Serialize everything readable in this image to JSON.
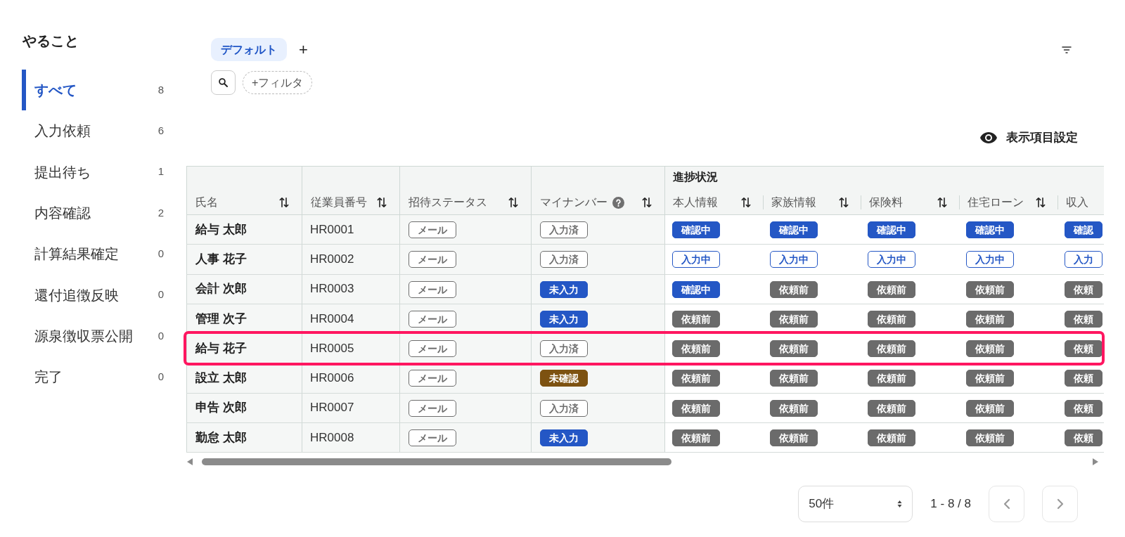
{
  "sidebar": {
    "title": "やること",
    "items": [
      {
        "label": "すべて",
        "count": "8",
        "selected": true
      },
      {
        "label": "入力依頼",
        "count": "6",
        "selected": false
      },
      {
        "label": "提出待ち",
        "count": "1",
        "selected": false
      },
      {
        "label": "内容確認",
        "count": "2",
        "selected": false
      },
      {
        "label": "計算結果確定",
        "count": "0",
        "selected": false
      },
      {
        "label": "還付追徴反映",
        "count": "0",
        "selected": false
      },
      {
        "label": "源泉徴収票公開",
        "count": "0",
        "selected": false
      },
      {
        "label": "完了",
        "count": "0",
        "selected": false
      }
    ]
  },
  "views": {
    "tabs": [
      {
        "label": "デフォルト",
        "selected": true
      }
    ],
    "add_tab": "+"
  },
  "filters": {
    "add_filter": "+フィルタ"
  },
  "column_settings": "表示項目設定",
  "table": {
    "columns": [
      {
        "label": "氏名",
        "help": false,
        "sort_icon": true
      },
      {
        "label": "従業員番号",
        "help": false,
        "sort_icon": true
      },
      {
        "label": "招待ステータス",
        "help": false,
        "sort_icon": true
      },
      {
        "label": "マイナンバー",
        "help": true,
        "sort_icon": true
      }
    ],
    "progress": {
      "label": "進捗状況",
      "columns": [
        {
          "label": "本人情報",
          "sort_icon": true
        },
        {
          "label": "家族情報",
          "sort_icon": true
        },
        {
          "label": "保険料",
          "sort_icon": true
        },
        {
          "label": "住宅ローン",
          "sort_icon": true
        },
        {
          "label": "収入",
          "sort_icon": false
        }
      ]
    },
    "rows": [
      {
        "name": "給与 太郎",
        "employee_no": "HR0001",
        "highlighted": false,
        "invitation": {
          "label": "メール",
          "kind": "outline",
          "color": "#6e6e6e"
        },
        "my_number": {
          "label": "入力済",
          "kind": "outline",
          "color": "#6e6e6e"
        },
        "progress": [
          {
            "label": "確認中",
            "kind": "solid",
            "color": "#2457c5"
          },
          {
            "label": "確認中",
            "kind": "solid",
            "color": "#2457c5"
          },
          {
            "label": "確認中",
            "kind": "solid",
            "color": "#2457c5"
          },
          {
            "label": "確認中",
            "kind": "solid",
            "color": "#2457c5"
          },
          {
            "label": "確認",
            "kind": "solid",
            "color": "#2457c5"
          }
        ]
      },
      {
        "name": "人事 花子",
        "employee_no": "HR0002",
        "highlighted": false,
        "invitation": {
          "label": "メール",
          "kind": "outline",
          "color": "#6e6e6e"
        },
        "my_number": {
          "label": "入力済",
          "kind": "outline",
          "color": "#6e6e6e"
        },
        "progress": [
          {
            "label": "入力中",
            "kind": "outline",
            "color": "#2457c5"
          },
          {
            "label": "入力中",
            "kind": "outline",
            "color": "#2457c5"
          },
          {
            "label": "入力中",
            "kind": "outline",
            "color": "#2457c5"
          },
          {
            "label": "入力中",
            "kind": "outline",
            "color": "#2457c5"
          },
          {
            "label": "入力",
            "kind": "outline",
            "color": "#2457c5"
          }
        ]
      },
      {
        "name": "会計 次郎",
        "employee_no": "HR0003",
        "highlighted": false,
        "invitation": {
          "label": "メール",
          "kind": "outline",
          "color": "#6e6e6e"
        },
        "my_number": {
          "label": "未入力",
          "kind": "solid",
          "color": "#2457c5"
        },
        "progress": [
          {
            "label": "確認中",
            "kind": "solid",
            "color": "#2457c5"
          },
          {
            "label": "依頼前",
            "kind": "solid",
            "color": "#6b6b6b"
          },
          {
            "label": "依頼前",
            "kind": "solid",
            "color": "#6b6b6b"
          },
          {
            "label": "依頼前",
            "kind": "solid",
            "color": "#6b6b6b"
          },
          {
            "label": "依頼",
            "kind": "solid",
            "color": "#6b6b6b"
          }
        ]
      },
      {
        "name": "管理 次子",
        "employee_no": "HR0004",
        "highlighted": false,
        "invitation": {
          "label": "メール",
          "kind": "outline",
          "color": "#6e6e6e"
        },
        "my_number": {
          "label": "未入力",
          "kind": "solid",
          "color": "#2457c5"
        },
        "progress": [
          {
            "label": "依頼前",
            "kind": "solid",
            "color": "#6b6b6b"
          },
          {
            "label": "依頼前",
            "kind": "solid",
            "color": "#6b6b6b"
          },
          {
            "label": "依頼前",
            "kind": "solid",
            "color": "#6b6b6b"
          },
          {
            "label": "依頼前",
            "kind": "solid",
            "color": "#6b6b6b"
          },
          {
            "label": "依頼",
            "kind": "solid",
            "color": "#6b6b6b"
          }
        ]
      },
      {
        "name": "給与 花子",
        "employee_no": "HR0005",
        "highlighted": true,
        "invitation": {
          "label": "メール",
          "kind": "outline",
          "color": "#6e6e6e"
        },
        "my_number": {
          "label": "入力済",
          "kind": "outline",
          "color": "#6e6e6e"
        },
        "progress": [
          {
            "label": "依頼前",
            "kind": "solid",
            "color": "#6b6b6b"
          },
          {
            "label": "依頼前",
            "kind": "solid",
            "color": "#6b6b6b"
          },
          {
            "label": "依頼前",
            "kind": "solid",
            "color": "#6b6b6b"
          },
          {
            "label": "依頼前",
            "kind": "solid",
            "color": "#6b6b6b"
          },
          {
            "label": "依頼",
            "kind": "solid",
            "color": "#6b6b6b"
          }
        ]
      },
      {
        "name": "設立 太郎",
        "employee_no": "HR0006",
        "highlighted": false,
        "invitation": {
          "label": "メール",
          "kind": "outline",
          "color": "#6e6e6e"
        },
        "my_number": {
          "label": "未確認",
          "kind": "solid",
          "color": "#7d5211"
        },
        "progress": [
          {
            "label": "依頼前",
            "kind": "solid",
            "color": "#6b6b6b"
          },
          {
            "label": "依頼前",
            "kind": "solid",
            "color": "#6b6b6b"
          },
          {
            "label": "依頼前",
            "kind": "solid",
            "color": "#6b6b6b"
          },
          {
            "label": "依頼前",
            "kind": "solid",
            "color": "#6b6b6b"
          },
          {
            "label": "依頼",
            "kind": "solid",
            "color": "#6b6b6b"
          }
        ]
      },
      {
        "name": "申告 次郎",
        "employee_no": "HR0007",
        "highlighted": false,
        "invitation": {
          "label": "メール",
          "kind": "outline",
          "color": "#6e6e6e"
        },
        "my_number": {
          "label": "入力済",
          "kind": "outline",
          "color": "#6e6e6e"
        },
        "progress": [
          {
            "label": "依頼前",
            "kind": "solid",
            "color": "#6b6b6b"
          },
          {
            "label": "依頼前",
            "kind": "solid",
            "color": "#6b6b6b"
          },
          {
            "label": "依頼前",
            "kind": "solid",
            "color": "#6b6b6b"
          },
          {
            "label": "依頼前",
            "kind": "solid",
            "color": "#6b6b6b"
          },
          {
            "label": "依頼",
            "kind": "solid",
            "color": "#6b6b6b"
          }
        ]
      },
      {
        "name": "勤怠 太郎",
        "employee_no": "HR0008",
        "highlighted": false,
        "invitation": {
          "label": "メール",
          "kind": "outline",
          "color": "#6e6e6e"
        },
        "my_number": {
          "label": "未入力",
          "kind": "solid",
          "color": "#2457c5"
        },
        "progress": [
          {
            "label": "依頼前",
            "kind": "solid",
            "color": "#6b6b6b"
          },
          {
            "label": "依頼前",
            "kind": "solid",
            "color": "#6b6b6b"
          },
          {
            "label": "依頼前",
            "kind": "solid",
            "color": "#6b6b6b"
          },
          {
            "label": "依頼前",
            "kind": "solid",
            "color": "#6b6b6b"
          },
          {
            "label": "依頼",
            "kind": "solid",
            "color": "#6b6b6b"
          }
        ]
      }
    ]
  },
  "pagination": {
    "page_size": "50件",
    "range": "1 - 8 / 8",
    "prev": {
      "disabled": true
    },
    "next": {
      "disabled": true
    }
  }
}
